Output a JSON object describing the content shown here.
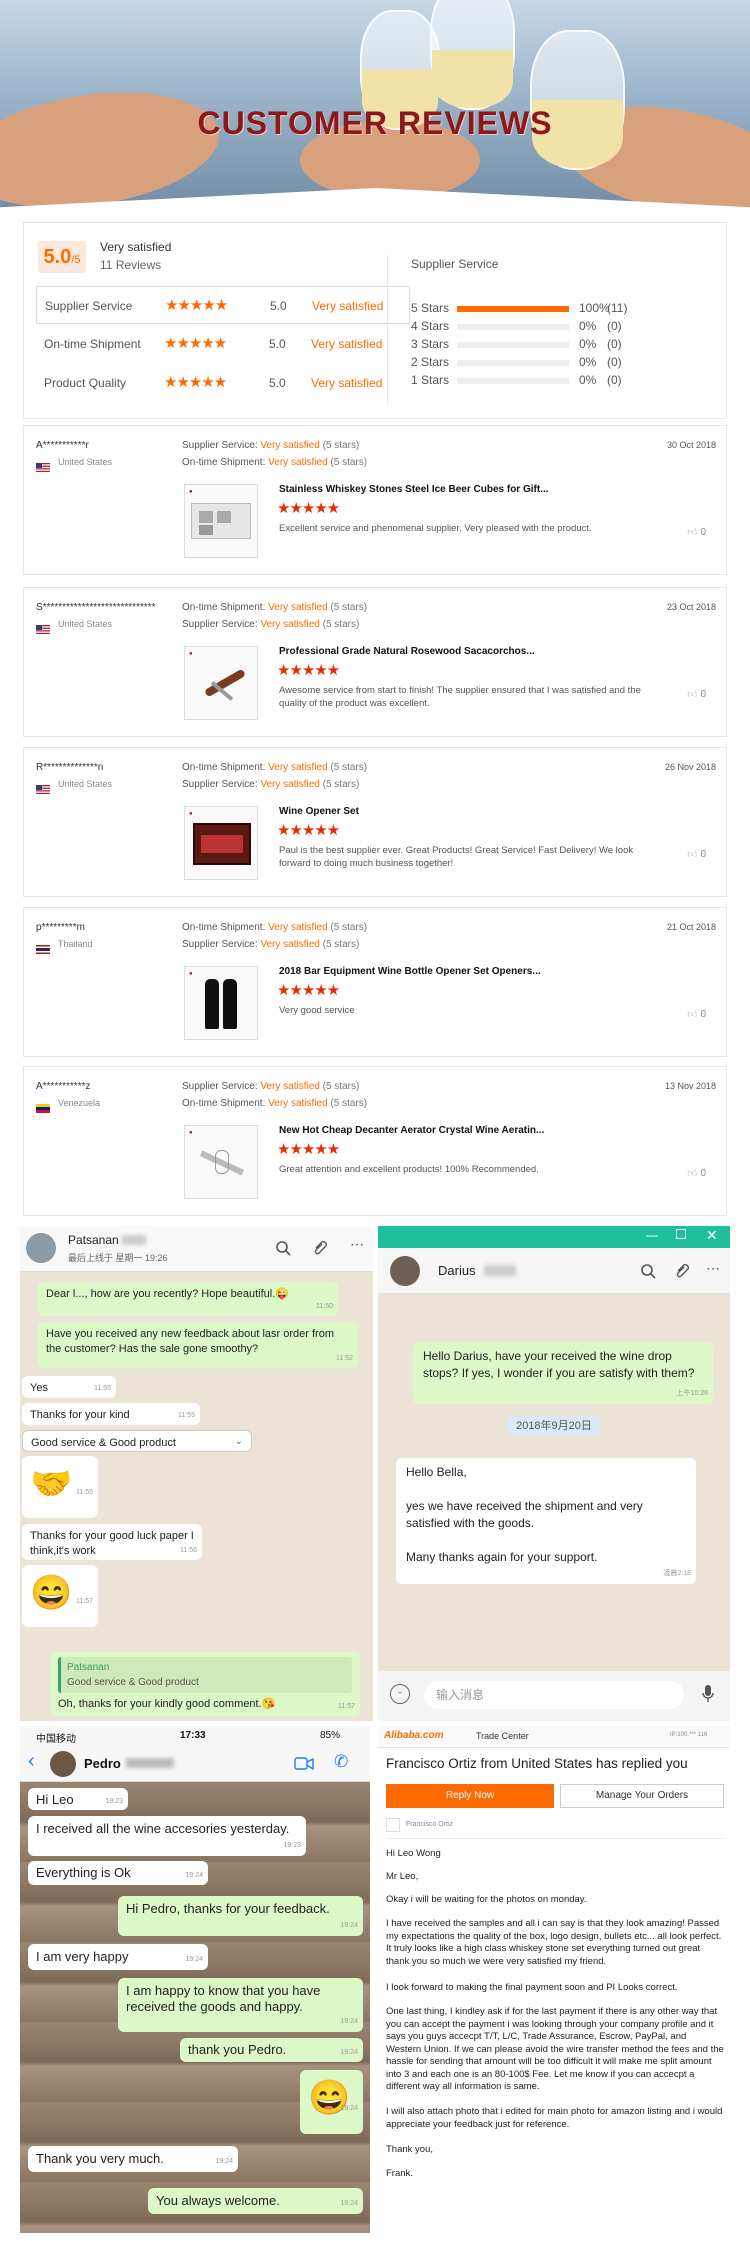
{
  "hero": {
    "title": "CUSTOMER REVIEWS"
  },
  "summary": {
    "score": "5.0",
    "score_suffix": "/5",
    "satisfaction": "Very satisfied",
    "reviews": "11 Reviews",
    "dimensions": [
      {
        "label": "Supplier Service",
        "stars": "★★★★★",
        "score": "5.0",
        "text": "Very satisfied"
      },
      {
        "label": "On-time Shipment",
        "stars": "★★★★★",
        "score": "5.0",
        "text": "Very satisfied"
      },
      {
        "label": "Product Quality",
        "stars": "★★★★★",
        "score": "5.0",
        "text": "Very satisfied"
      }
    ],
    "stars_heading": "Supplier Service",
    "star_rows": [
      {
        "label": "5 Stars",
        "fill": 1.0,
        "pct": "100%",
        "count": "(11)"
      },
      {
        "label": "4 Stars",
        "fill": 0,
        "pct": "0%",
        "count": "(0)"
      },
      {
        "label": "3 Stars",
        "fill": 0,
        "pct": "0%",
        "count": "(0)"
      },
      {
        "label": "2 Stars",
        "fill": 0,
        "pct": "0%",
        "count": "(0)"
      },
      {
        "label": "1 Stars",
        "fill": 0,
        "pct": "0%",
        "count": "(0)"
      }
    ]
  },
  "reviews": [
    {
      "buyer": "A***********r",
      "country": "United States",
      "flag": "us",
      "l1": "Supplier Service:",
      "v1": "Very satisfied",
      "s1": "(5 stars)",
      "l2": "On-time Shipment:",
      "v2": "Very satisfied",
      "s2": "(5 stars)",
      "date": "30 Oct 2018",
      "product": "Stainless Whiskey Stones Steel Ice Beer Cubes for Gift...",
      "stars": "★★★★★",
      "text": "Excellent service and phenomenal supplier. Very pleased with the product.",
      "likes": "0"
    },
    {
      "buyer": "S*****************************",
      "country": "United States",
      "flag": "us",
      "l1": "On-time Shipment:",
      "v1": "Very satisfied",
      "s1": "(5 stars)",
      "l2": "Supplier Service:",
      "v2": "Very satisfied",
      "s2": "(5 stars)",
      "date": "23 Oct 2018",
      "product": "Professional Grade Natural Rosewood Sacacorchos...",
      "stars": "★★★★★",
      "text": "Awesome service from start to finish! The supplier ensured that I was satisfied and the quality of the product was excellent.",
      "likes": "0"
    },
    {
      "buyer": "R**************n",
      "country": "United States",
      "flag": "us",
      "l1": "On-time Shipment:",
      "v1": "Very satisfied",
      "s1": "(5 stars)",
      "l2": "Supplier Service:",
      "v2": "Very satisfied",
      "s2": "(5 stars)",
      "date": "26 Nov 2018",
      "product": "Wine Opener Set",
      "stars": "★★★★★",
      "text": "Paul is the best supplier ever. Great Products! Great Service! Fast Delivery! We look forward to doing much business together!",
      "likes": "0"
    },
    {
      "buyer": "p*********m",
      "country": "Thailand",
      "flag": "th",
      "l1": "On-time Shipment:",
      "v1": "Very satisfied",
      "s1": "(5 stars)",
      "l2": "Supplier Service:",
      "v2": "Very satisfied",
      "s2": "(5 stars)",
      "date": "21 Oct 2018",
      "product": "2018 Bar Equipment Wine Bottle Opener Set Openers...",
      "stars": "★★★★★",
      "text": "Very good service",
      "likes": "0"
    },
    {
      "buyer": "A***********z",
      "country": "Venezuela",
      "flag": "ve",
      "l1": "Supplier Service:",
      "v1": "Very satisfied",
      "s1": "(5 stars)",
      "l2": "On-time Shipment:",
      "v2": "Very satisfied",
      "s2": "(5 stars)",
      "date": "13 Nov 2018",
      "product": "New Hot Cheap Decanter Aerator Crystal Wine Aeratin...",
      "stars": "★★★★★",
      "text": "Great attention and excellent products! 100% Recommended.",
      "likes": "0"
    }
  ],
  "chat1": {
    "name": "Patsanan",
    "status": "最后上线于 星期一 19:26",
    "messages": [
      {
        "text": "Dear l..., how are you recently? Hope beautiful.😜",
        "time": "11:50"
      },
      {
        "text": "Have you received any new feedback about lasr order from the customer? Has the sale gone smoothy?",
        "time": "11:52"
      },
      {
        "text": "Yes",
        "time": "11:55"
      },
      {
        "text": "Thanks for your kind",
        "time": "11:55"
      },
      {
        "text": "Good service & Good product",
        "time": ""
      },
      {
        "text": "🤝",
        "time": "11:55"
      },
      {
        "text": "Thanks for your good luck paper I think,it's work",
        "time": "11:56"
      },
      {
        "text": "😄",
        "time": "11:57"
      },
      {
        "text": "Patsanan",
        "time": ""
      },
      {
        "text": "Good service & Good product",
        "time": ""
      },
      {
        "text": "Oh, thanks for your kindly good comment.😘",
        "time": "11:57"
      }
    ]
  },
  "chat2": {
    "name": "Darius",
    "messages": [
      {
        "text": "Hello Darius, have your received the wine drop stops? If yes, I wonder if you are satisfy with them?",
        "time": "上午10:28"
      },
      {
        "text": "2018年9月20日",
        "time": ""
      },
      {
        "text": "Hello Bella,",
        "time": ""
      },
      {
        "text": "yes we have received the shipment and very satisfied with the goods.",
        "time": ""
      },
      {
        "text": "Many thanks again for your support.",
        "time": "凌晨2:18"
      }
    ],
    "input_placeholder": "输入消息"
  },
  "chat3": {
    "carrier": "中国移动",
    "clock": "17:33",
    "battery": "85%",
    "name": "Pedro",
    "messages": [
      {
        "text": "Hi Leo",
        "time": "19:23"
      },
      {
        "text": "I received all the wine accesories yesterday.",
        "time": "19:23"
      },
      {
        "text": "Everything is Ok",
        "time": "19:24"
      },
      {
        "text": "Hi Pedro, thanks for your feedback.",
        "time": "19:24"
      },
      {
        "text": "I am very happy",
        "time": "19:24"
      },
      {
        "text": "I am happy to know that you have received the goods and happy.",
        "time": "19:24"
      },
      {
        "text": "thank you Pedro.",
        "time": "19:24"
      },
      {
        "text": "😄",
        "time": "19:24"
      },
      {
        "text": "Thank you very much.",
        "time": "19:24"
      },
      {
        "text": "You always welcome.",
        "time": "19:24"
      }
    ]
  },
  "mail": {
    "logo": "Alibaba.com",
    "center": "Trade Center",
    "ip": "IP:100.*** 116",
    "headline": "Francisco Ortiz from United States has replied you",
    "reply": "Reply Now",
    "manage": "Manage Your Orders",
    "sender": "Francisco Ortiz",
    "p1": "Hi Leo Wong",
    "p2": "Mr Leo,",
    "p3": "Okay i will be waiting for the photos on monday.",
    "p4": "I have received the samples and all i can say is that they look amazing! Passed my expectations the quality of the box, logo design, bullets etc... all look perfect. It truly looks like a high class whiskey stone set everything turned out great thank you so much we were very satisfied my friend.",
    "p5": "I look forward to making the final payment soon and PI Looks correct.",
    "p6": "One last thing, I kindley ask if for the last payment if there is any other way that you can accept the payment i was looking through your company profile and it says you guys accecpt T/T, L/C, Trade Assurance, Escrow, PayPal, and Western Union. If we can please avoid the wire transfer method the fees and the hassle for sending that amount will be too difficult it will make me split amount into 3 and each one is an 80-100$ Fee. Let me know if you can accecpt a different way all information is same.",
    "p7": "I will also attach photo that i edited for main photo for amazon listing and i would appreciate your feedback just for reference.",
    "p8": "Thank you,",
    "p9": "Frank."
  }
}
